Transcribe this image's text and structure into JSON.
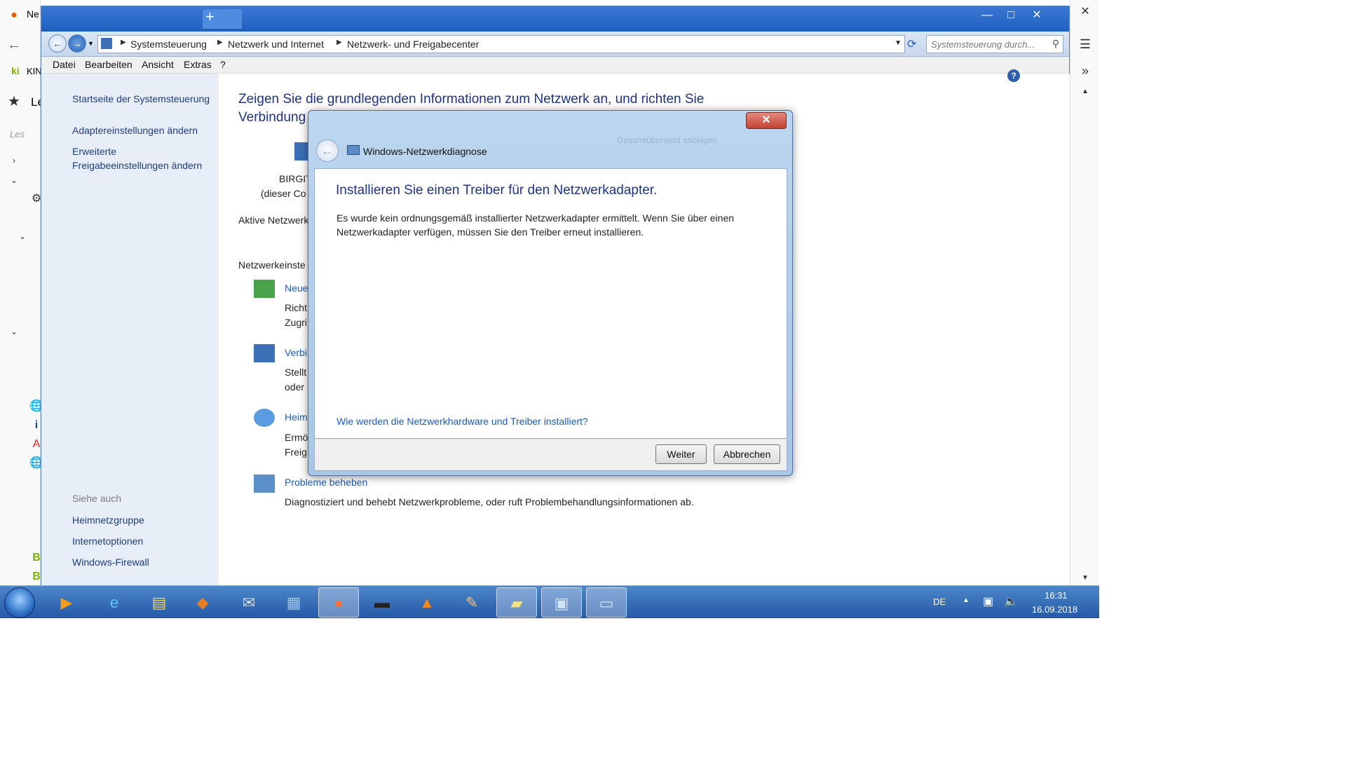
{
  "firefox": {
    "tab_label": "Ne",
    "left_label_kino": "KIN",
    "left_label_le": "Le",
    "left_search": "Les"
  },
  "window": {
    "address": [
      "Systemsteuerung",
      "Netzwerk und Internet",
      "Netzwerk- und Freigabecenter"
    ],
    "search_placeholder": "Systemsteuerung durch...",
    "menu": [
      "Datei",
      "Bearbeiten",
      "Ansicht",
      "Extras",
      "?"
    ]
  },
  "left_pane": {
    "links": [
      "Startseite der Systemsteuerung",
      "Adaptereinstellungen ändern",
      "Erweiterte",
      "Freigabeeinstellungen ändern"
    ],
    "see_also_label": "Siehe auch",
    "see_also": [
      "Heimnetzgruppe",
      "Internetoptionen",
      "Windows-Firewall"
    ]
  },
  "main": {
    "heading_line1": "Zeigen Sie die grundlegenden Informationen zum Netzwerk an, und richten Sie",
    "heading_line2": "Verbindung",
    "computer_name": "BIRGIT",
    "computer_sub": "(dieser Co",
    "active_networks": "Aktive Netzwerk",
    "network_settings": "Netzwerkeinste",
    "items": [
      {
        "title": "Neue",
        "line1": "Richt",
        "line2": "Zugri"
      },
      {
        "title": "Verbi",
        "line1": "Stellt",
        "line2": "oder"
      },
      {
        "title": "Heim",
        "line1": "Ermö",
        "line2": "Freig"
      }
    ],
    "troubleshoot_title": "Probleme beheben",
    "troubleshoot_desc": "Diagnostiziert und behebt Netzwerkprobleme, oder ruft Problembehandlungsinformationen ab."
  },
  "dialog": {
    "title": "Windows-Netzwerkdiagnose",
    "faded_text": "Gesamtübersicht anzeigen",
    "heading": "Installieren Sie einen Treiber für den Netzwerkadapter.",
    "body": "Es wurde kein ordnungsgemäß installierter Netzwerkadapter ermittelt. Wenn Sie über einen Netzwerkadapter verfügen, müssen Sie den Treiber erneut installieren.",
    "link": "Wie werden die Netzwerkhardware und Treiber installiert?",
    "next_label": "Weiter",
    "cancel_label": "Abbrechen",
    "close_glyph": "✕"
  },
  "taskbar": {
    "language": "DE",
    "time": "16:31",
    "date": "16.09.2018"
  }
}
